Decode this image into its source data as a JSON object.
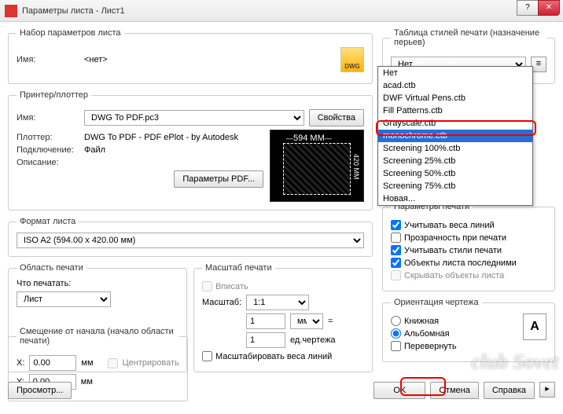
{
  "title": "Параметры листа - Лист1",
  "dwg_badge": "DWG",
  "page_set": {
    "legend": "Набор параметров листа",
    "name_label": "Имя:",
    "name_value": "<нет>"
  },
  "printer": {
    "legend": "Принтер/плоттер",
    "name_label": "Имя:",
    "name_value": "DWG To PDF.pc3",
    "props_btn": "Свойства",
    "plotter_label": "Плоттер:",
    "plotter_value": "DWG To PDF - PDF ePlot - by Autodesk",
    "conn_label": "Подключение:",
    "conn_value": "Файл",
    "desc_label": "Описание:",
    "pdf_btn": "Параметры PDF...",
    "preview_w": "594 MM",
    "preview_h": "420 MM"
  },
  "paper": {
    "legend": "Формат листа",
    "value": "ISO A2 (594.00 x 420.00 мм)"
  },
  "area": {
    "legend": "Область печати",
    "what_label": "Что печатать:",
    "what_value": "Лист"
  },
  "scale": {
    "legend": "Масштаб печати",
    "fit_label": "Вписать",
    "scale_label": "Масштаб:",
    "scale_value": "1:1",
    "num": "1",
    "unit": "мм",
    "eq": "=",
    "denom": "1",
    "denom_unit": "ед.чертежа",
    "scalelw_label": "Масштабировать веса линий"
  },
  "offset": {
    "legend": "Смещение от начала (начало области печати)",
    "x_label": "X:",
    "x_value": "0.00",
    "y_label": "Y:",
    "y_value": "0.00",
    "unit": "мм",
    "center_label": "Центрировать"
  },
  "styles": {
    "legend": "Таблица стилей печати (назначение перьев)",
    "selected": "Нет",
    "options": [
      "Нет",
      "acad.ctb",
      "DWF Virtual Pens.ctb",
      "Fill Patterns.ctb",
      "Grayscale.ctb",
      "monochrome.ctb",
      "Screening 100%.ctb",
      "Screening 25%.ctb",
      "Screening 50%.ctb",
      "Screening 75%.ctb",
      "Новая..."
    ]
  },
  "shaded": {
    "legend": "Параметры печати",
    "lw": "Учитывать веса линий",
    "transp": "Прозрачность при печати",
    "styles": "Учитывать стили печати",
    "paperspace": "Объекты листа последними",
    "hide": "Скрывать объекты листа"
  },
  "orient": {
    "legend": "Ориентация чертежа",
    "portrait": "Книжная",
    "landscape": "Альбомная",
    "upside": "Перевернуть",
    "letter": "A"
  },
  "buttons": {
    "preview": "Просмотр...",
    "ok": "OK",
    "cancel": "Отмена",
    "help": "Справка"
  },
  "watermark": "club Sovet"
}
